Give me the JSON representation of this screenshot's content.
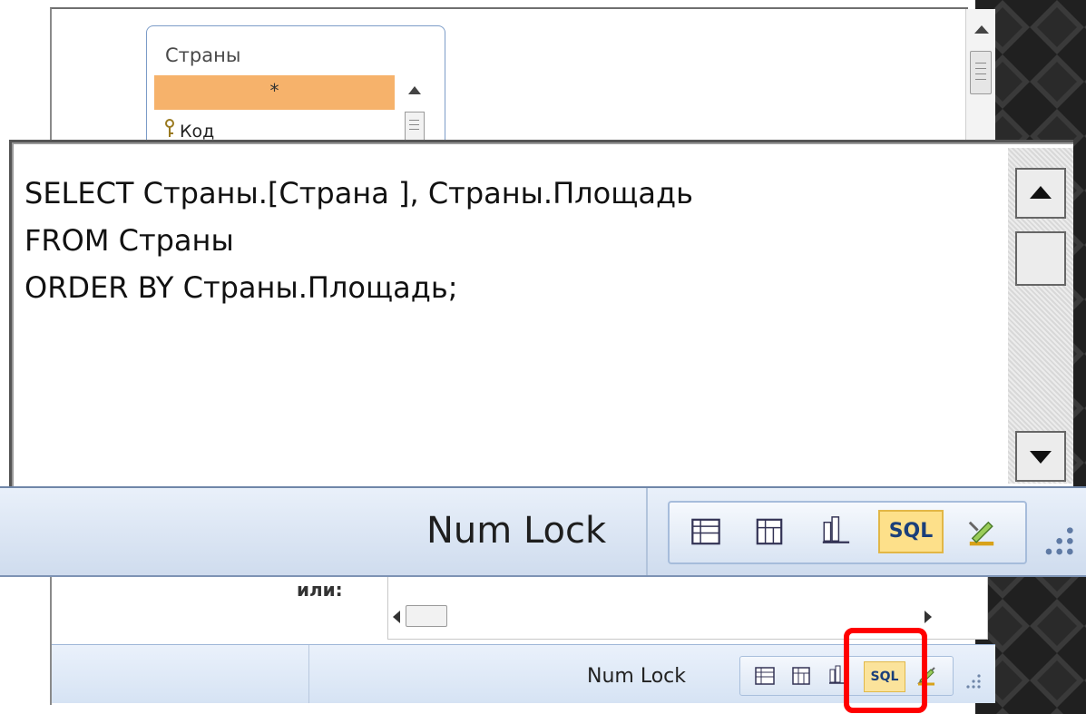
{
  "background_window": {
    "table_title": "Страны",
    "table_star": "*",
    "table_field": "Код",
    "criteria_label": "или:",
    "status_num_lock": "Num Lock",
    "view_sql_label": "SQL"
  },
  "sql_view": {
    "lines": [
      "SELECT Страны.[Страна ], Страны.Площадь",
      "FROM Страны",
      "ORDER BY Страны.Площадь;"
    ],
    "status_num_lock": "Num Lock",
    "view_sql_label": "SQL"
  },
  "colors": {
    "highlight_row": "#f6b26b",
    "active_view": "#fde08a",
    "annotation": "#ff0000"
  }
}
